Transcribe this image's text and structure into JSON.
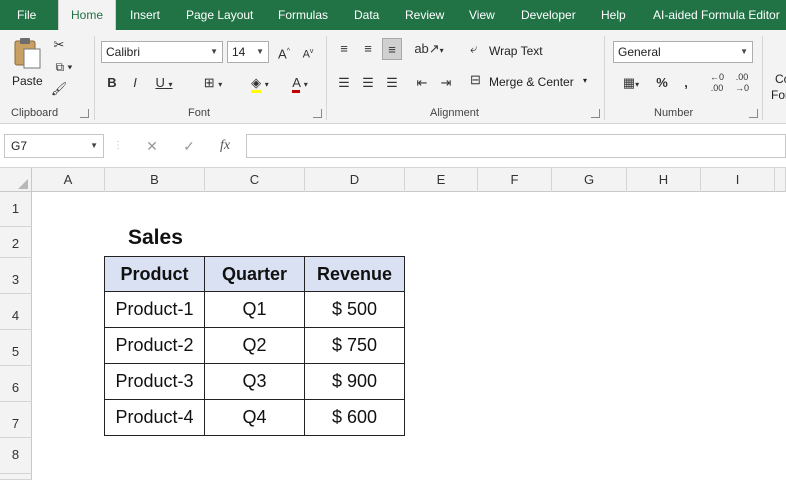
{
  "tabs": [
    {
      "label": "File",
      "active": false
    },
    {
      "label": "Home",
      "active": true
    },
    {
      "label": "Insert",
      "active": false
    },
    {
      "label": "Page Layout",
      "active": false
    },
    {
      "label": "Formulas",
      "active": false
    },
    {
      "label": "Data",
      "active": false
    },
    {
      "label": "Review",
      "active": false
    },
    {
      "label": "View",
      "active": false
    },
    {
      "label": "Developer",
      "active": false
    },
    {
      "label": "Help",
      "active": false
    },
    {
      "label": "AI-aided Formula Editor",
      "active": false
    }
  ],
  "ribbon": {
    "clipboard": {
      "paste_label": "Paste",
      "group_label": "Clipboard"
    },
    "font": {
      "font_name": "Calibri",
      "font_size": "14",
      "group_label": "Font",
      "bold": "B",
      "italic": "I",
      "underline": "U"
    },
    "alignment": {
      "wrap_text": "Wrap Text",
      "merge_center": "Merge & Center",
      "group_label": "Alignment"
    },
    "number": {
      "format": "General",
      "percent": "%",
      "comma": ",",
      "group_label": "Number",
      "inc_decimal": ".00",
      "dec_decimal": ".00"
    },
    "cut_off_label_1": "Co",
    "cut_off_label_2": "For"
  },
  "formula_bar": {
    "name_box": "G7",
    "cancel": "✕",
    "enter": "✓",
    "fx": "fx",
    "value": ""
  },
  "columns": [
    "A",
    "B",
    "C",
    "D",
    "E",
    "F",
    "G",
    "H",
    "I"
  ],
  "rows": [
    "1",
    "2",
    "3",
    "4",
    "5",
    "6",
    "7",
    "8"
  ],
  "sheet": {
    "title": "Sales",
    "table": {
      "headers": [
        "Product",
        "Quarter",
        "Revenue"
      ],
      "rows": [
        [
          "Product-1",
          "Q1",
          "$ 500"
        ],
        [
          "Product-2",
          "Q2",
          "$ 750"
        ],
        [
          "Product-3",
          "Q3",
          "$ 900"
        ],
        [
          "Product-4",
          "Q4",
          "$ 600"
        ]
      ]
    }
  },
  "colors": {
    "ribbon_green": "#217346",
    "header_fill": "#d9e1f2"
  }
}
